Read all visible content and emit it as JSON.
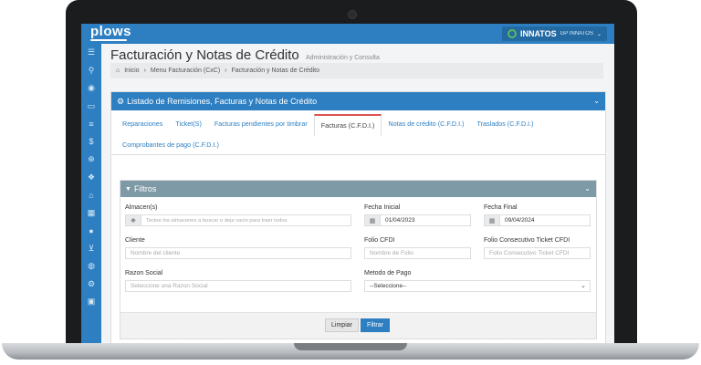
{
  "topbar": {
    "logo": "plows",
    "brand_name": "INNATOS",
    "brand_sub": "GP INNATOS"
  },
  "page": {
    "title": "Facturación y Notas de Crédito",
    "subtitle": "Administración y Consulta"
  },
  "breadcrumb": [
    "Inicio",
    "Menu Facturación (CxC)",
    "Facturación y Notas de Crédito"
  ],
  "panel": {
    "title": "Listado de Remisiones, Facturas y Notas de Crédito",
    "tabs": [
      "Reparaciones",
      "Ticket(S)",
      "Facturas pendientes por timbrar",
      "Facturas (C.F.D.I.)",
      "Notas de crédito (C.F.D.I.)",
      "Traslados (C.F.D.I.)",
      "Comprobantes de pago (C.F.D.I.)"
    ],
    "active_tab_index": 3
  },
  "filters": {
    "title": "Filtros",
    "almacen": {
      "label": "Almacen(s)",
      "placeholder": "Teclee los almacenes a buscar o deje vacio para traer todos."
    },
    "fecha_inicial": {
      "label": "Fecha Inicial",
      "value": "01/04/2023"
    },
    "fecha_final": {
      "label": "Fecha Final",
      "value": "09/04/2024"
    },
    "cliente": {
      "label": "Cliente",
      "placeholder": "Nombre del cliente"
    },
    "folio_cfdi": {
      "label": "Folio CFDI",
      "placeholder": "Nombre de Folio"
    },
    "folio_ticket": {
      "label": "Folio Consecutivo Ticket CFDI",
      "placeholder": "Folio Consecutivo Ticket CFDI"
    },
    "razon_social": {
      "label": "Razon Social",
      "placeholder": "Seleccione una Razon Social"
    },
    "metodo_pago": {
      "label": "Metodo de Pago",
      "value": "--Seleccione--"
    },
    "clear_label": "Limpiar",
    "filter_label": "Filtrar"
  },
  "sidebar_icons": [
    "menu-icon",
    "search-icon",
    "eye-icon",
    "folder-icon",
    "list-icon",
    "dollar-icon",
    "globe-icon",
    "cubes-icon",
    "bank-icon",
    "calculator-icon",
    "globe2-icon",
    "cart-icon",
    "world-icon",
    "gear-icon",
    "lock-icon"
  ],
  "colors": {
    "primary": "#2d7fc1",
    "filters_header": "#7f9aa7",
    "active_tab_border": "#d9534f"
  }
}
